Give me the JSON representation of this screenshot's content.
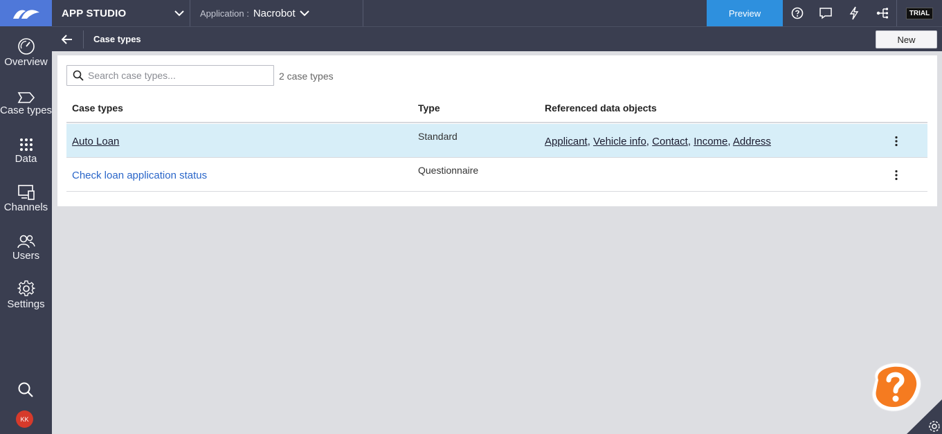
{
  "topbar": {
    "studio_label": "APP STUDIO",
    "app_label": "Application :",
    "app_value": "Nacrobot",
    "preview_label": "Preview",
    "trial_label": "TRIAL",
    "icons": [
      "help-icon",
      "chat-icon",
      "lightning-icon",
      "hierarchy-icon"
    ]
  },
  "sidebar": {
    "items": [
      {
        "label": "Overview",
        "icon": "dashboard-gauge-icon"
      },
      {
        "label": "Case types",
        "icon": "case-tag-icon"
      },
      {
        "label": "Data",
        "icon": "grid-dots-icon"
      },
      {
        "label": "Channels",
        "icon": "devices-icon"
      },
      {
        "label": "Users",
        "icon": "users-icon"
      },
      {
        "label": "Settings",
        "icon": "gear-icon"
      }
    ],
    "avatar_initials": "KK"
  },
  "subheader": {
    "title": "Case types",
    "new_label": "New"
  },
  "main": {
    "search_placeholder": "Search case types...",
    "count_text": "2 case types",
    "columns": [
      "Case types",
      "Type",
      "Referenced data objects"
    ],
    "rows": [
      {
        "name": "Auto Loan",
        "type": "Standard",
        "refs": [
          "Applicant",
          "Vehicle info",
          "Contact",
          "Income",
          "Address"
        ],
        "selected": true
      },
      {
        "name": "Check loan application status",
        "type": "Questionnaire",
        "refs": [],
        "selected": false
      }
    ]
  },
  "colors": {
    "chrome": "#3a3e50",
    "logo_bg": "#4f78d9",
    "preview_bg": "#2e90de",
    "selected_row": "#d7eef8",
    "link": "#2a66c9",
    "avatar": "#d63a2b",
    "help_fab": "#f57b20"
  }
}
